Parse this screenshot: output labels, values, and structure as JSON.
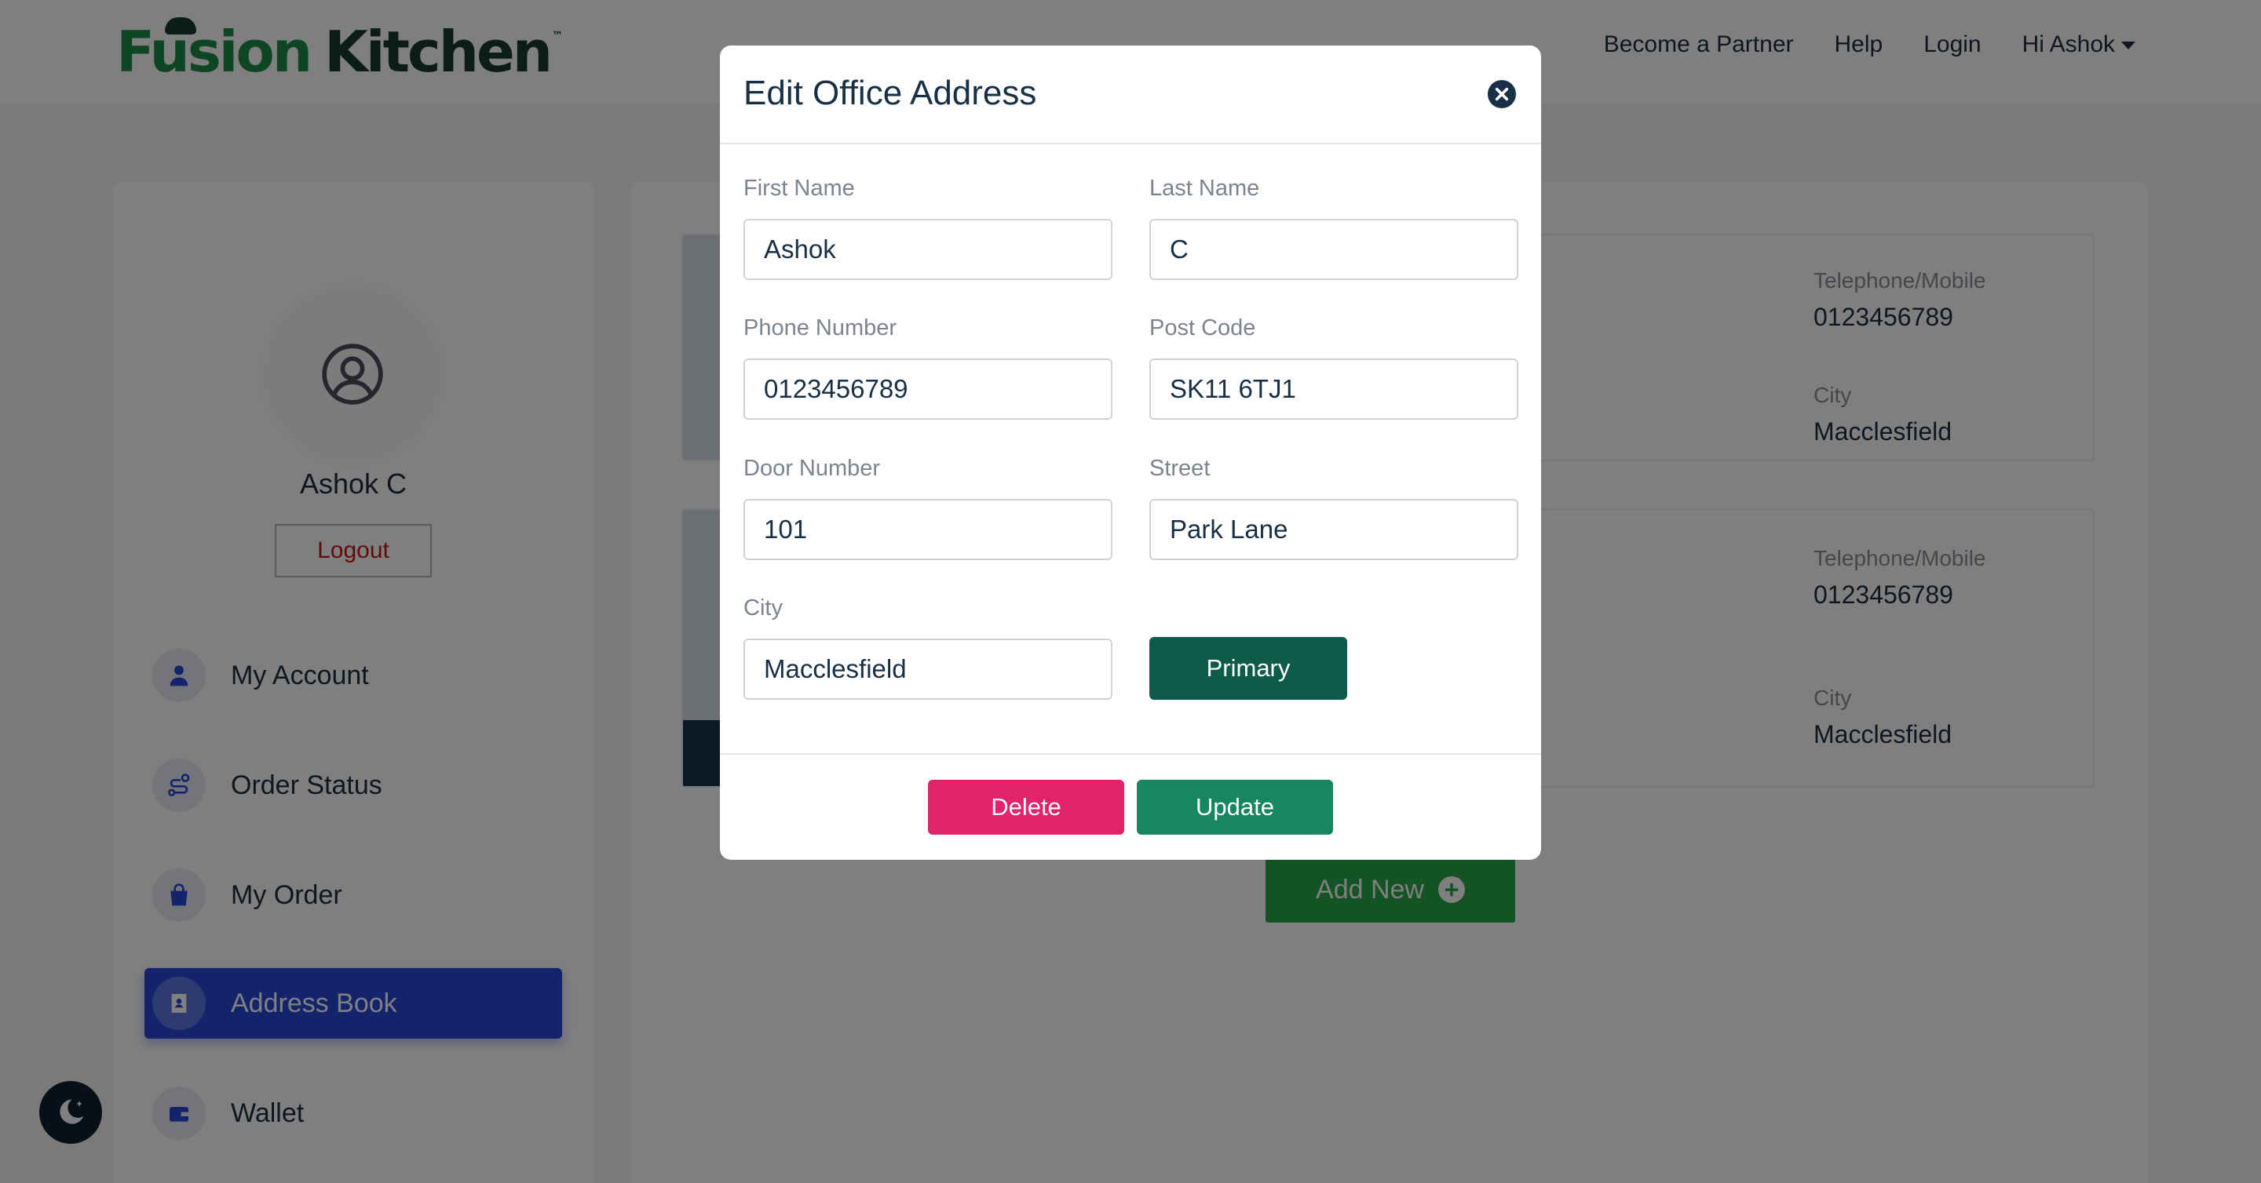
{
  "header": {
    "logo_text_green": "Fusion",
    "logo_text_dark": "Kitchen",
    "logo_tm": "™",
    "nav": {
      "partner": "Become a Partner",
      "help": "Help",
      "login": "Login",
      "user": "Hi Ashok"
    }
  },
  "sidebar": {
    "user_name": "Ashok C",
    "logout_label": "Logout",
    "items": [
      {
        "label": "My Account",
        "icon": "user-icon"
      },
      {
        "label": "Order Status",
        "icon": "route-icon"
      },
      {
        "label": "My Order",
        "icon": "shopping-bag-icon"
      },
      {
        "label": "Address Book",
        "icon": "address-book-icon",
        "active": true
      },
      {
        "label": "Wallet",
        "icon": "wallet-icon"
      }
    ]
  },
  "addresses": [
    {
      "phone_label": "Telephone/Mobile",
      "phone": "0123456789",
      "city_label": "City",
      "city": "Macclesfield"
    },
    {
      "phone_label": "Telephone/Mobile",
      "phone": "0123456789",
      "city_label": "City",
      "city": "Macclesfield"
    }
  ],
  "add_new_label": "Add New",
  "modal": {
    "title": "Edit Office Address",
    "fields": {
      "first_name": {
        "label": "First Name",
        "value": "Ashok"
      },
      "last_name": {
        "label": "Last Name",
        "value": "C"
      },
      "phone": {
        "label": "Phone Number",
        "value": "0123456789"
      },
      "post_code": {
        "label": "Post Code",
        "value": "SK11 6TJ1"
      },
      "door": {
        "label": "Door Number",
        "value": "101"
      },
      "street": {
        "label": "Street",
        "value": "Park Lane"
      },
      "city": {
        "label": "City",
        "value": "Macclesfield"
      }
    },
    "primary_label": "Primary",
    "delete_label": "Delete",
    "update_label": "Update"
  },
  "colors": {
    "brand_green": "#1d8a45",
    "active_blue": "#2649d9",
    "primary_dark_green": "#0d5c4a",
    "delete_pink": "#e2236a",
    "update_green": "#16875f",
    "add_new_green": "#26a648"
  }
}
